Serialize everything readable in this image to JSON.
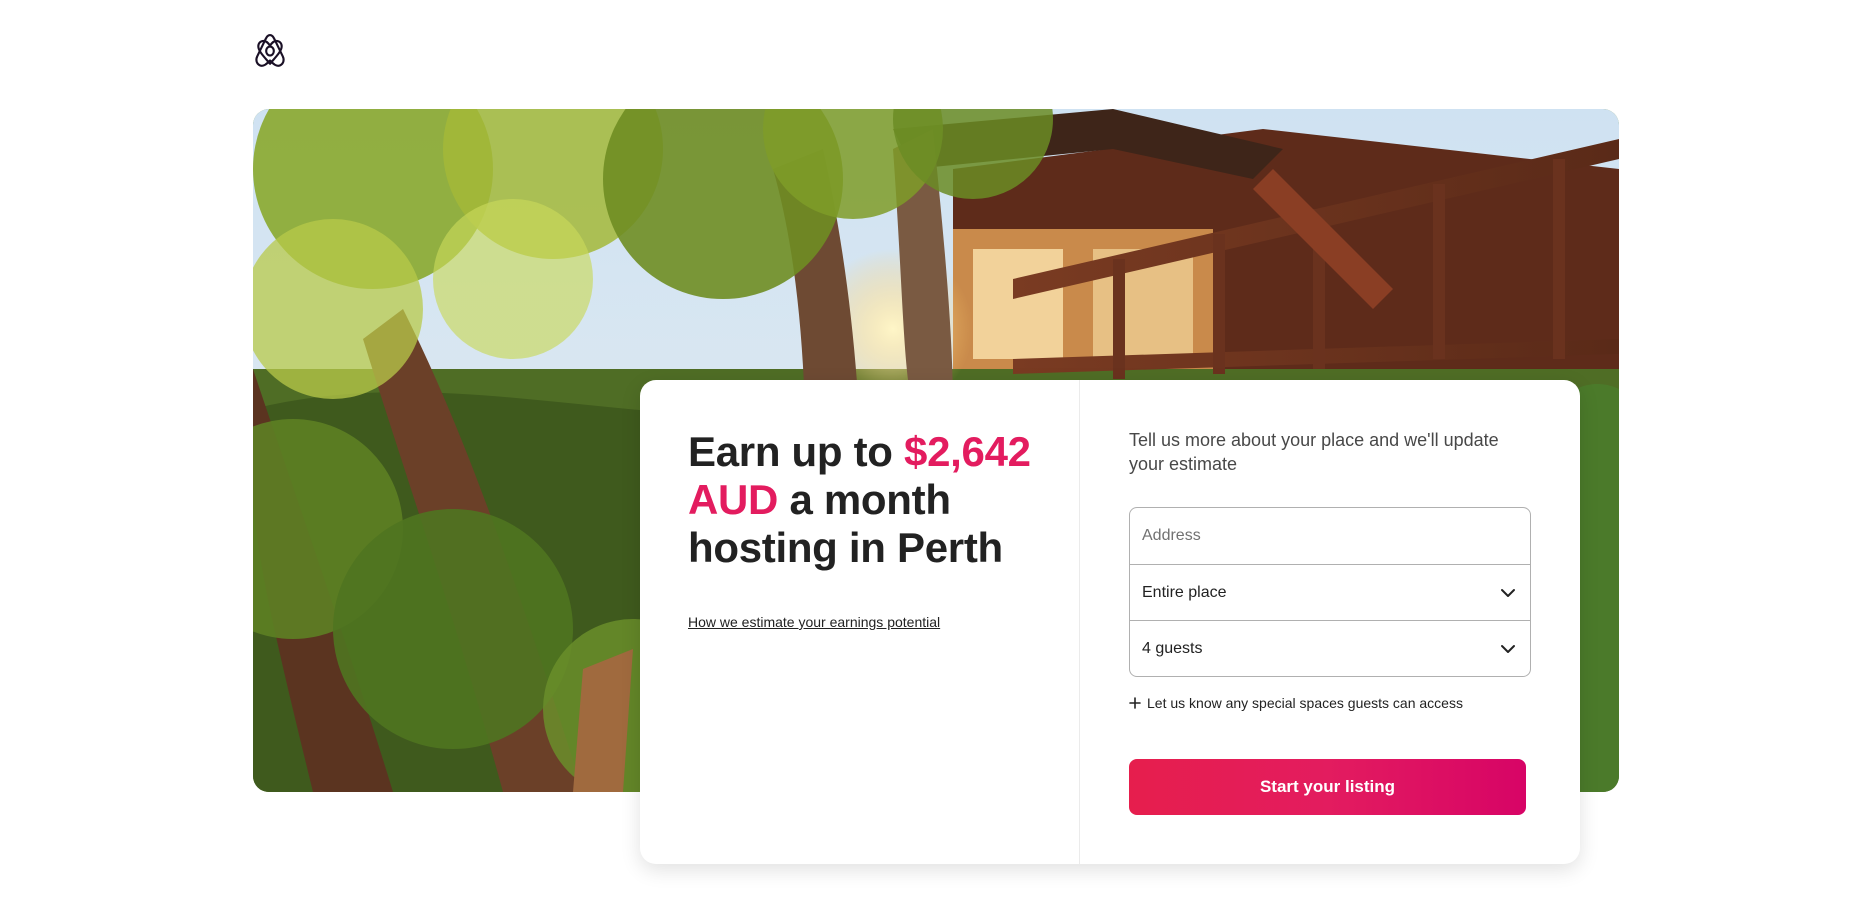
{
  "header": {
    "logo_icon": "airbnb-logo-icon"
  },
  "hero": {
    "image_icon": "treehouse-photo"
  },
  "card": {
    "headline": {
      "prefix": "Earn up to ",
      "amount": "$2,642 AUD",
      "suffix": " a month hosting in Perth"
    },
    "estimate_link": "How we estimate your earnings potential",
    "intro": "Tell us more about your place and we'll update your estimate",
    "form": {
      "address_placeholder": "Address",
      "address_value": "",
      "place_type": "Entire place",
      "guests": "4 guests"
    },
    "special_spaces": "Let us know any special spaces guests can access",
    "cta_label": "Start your listing"
  },
  "colors": {
    "accent": "#e31c5f",
    "button_start": "#e61e4d",
    "button_end": "#d70466",
    "text": "#222222"
  }
}
